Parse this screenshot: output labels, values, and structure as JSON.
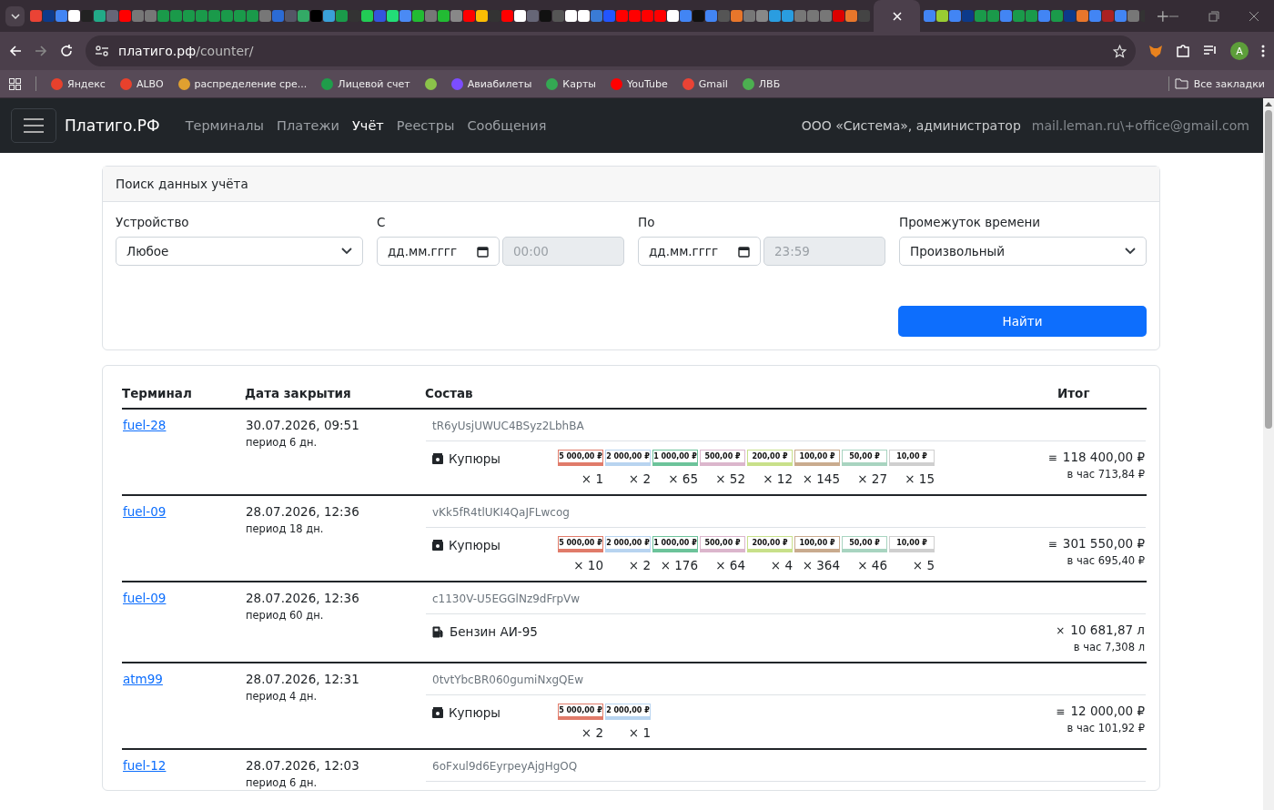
{
  "browser": {
    "url_host": "платиго.рф",
    "url_path": "/counter/",
    "bookmarks": [
      {
        "label": "Яндекс",
        "color": "#e8412c"
      },
      {
        "label": "ALBO",
        "color": "#e8412c"
      },
      {
        "label": "распределение сре...",
        "color": "#e0a030"
      },
      {
        "label": "Лицевой счет",
        "color": "#1f9d4a"
      },
      {
        "color": "#8bc34a"
      },
      {
        "label": "Авиабилеты",
        "color": "#7c4dff"
      },
      {
        "label": "Карты",
        "color": "#34a853"
      },
      {
        "label": "YouTube",
        "color": "#ff0000"
      },
      {
        "label": "Gmail",
        "color": "#ea4335"
      },
      {
        "label": "ЛВБ",
        "color": "#4caf50"
      }
    ],
    "all_bookmarks": "Все закладки",
    "profile": "A"
  },
  "navbar": {
    "brand": "Платиго.РФ",
    "links": [
      {
        "label": "Терминалы",
        "selected": false
      },
      {
        "label": "Платежи",
        "selected": false
      },
      {
        "label": "Учёт",
        "selected": true
      },
      {
        "label": "Реестры",
        "selected": false
      },
      {
        "label": "Сообщения",
        "selected": false
      }
    ],
    "user": "ООО «Система», администратор",
    "email": "mail.leman.ru\\+office@gmail.com"
  },
  "search": {
    "title": "Поиск данных учёта",
    "device_label": "Устройство",
    "device_value": "Любое",
    "from_label": "С",
    "from_date": "дд.мм.гггг",
    "from_time": "00:00",
    "to_label": "По",
    "to_date": "дд.мм.гггг",
    "to_time": "23:59",
    "range_label": "Промежуток времени",
    "range_value": "Произвольный",
    "button": "Найти"
  },
  "table": {
    "columns": [
      "Терминал",
      "Дата закрытия",
      "Состав",
      "Итог"
    ],
    "rows": [
      {
        "terminal": "fuel-28",
        "date": "30.07.2026, 09:51",
        "period": "период 6 дн.",
        "id": "tR6yUsjUWUC4BSyz2LbhBA",
        "item": {
          "kind": "bills",
          "label": "Купюры",
          "notes": [
            {
              "label": "5 000,00 ₽",
              "color": "#e07b6a",
              "count": "× 1"
            },
            {
              "label": "2 000,00 ₽",
              "color": "#b8d4f0",
              "count": "× 2"
            },
            {
              "label": "1 000,00 ₽",
              "color": "#6cc39a",
              "count": "× 65"
            },
            {
              "label": "500,00 ₽",
              "color": "#dbb6cc",
              "count": "× 52"
            },
            {
              "label": "200,00 ₽",
              "color": "#c8e08a",
              "count": "× 12"
            },
            {
              "label": "100,00 ₽",
              "color": "#c9ab8e",
              "count": "× 145"
            },
            {
              "label": "50,00 ₽",
              "color": "#a8d4c0",
              "count": "× 27"
            },
            {
              "label": "10,00 ₽",
              "color": "#cfcfcf",
              "count": "× 15"
            }
          ],
          "symbol": "≡",
          "total": "118 400,00 ₽",
          "per_hour": "в час 713,84 ₽"
        }
      },
      {
        "terminal": "fuel-09",
        "date": "28.07.2026, 12:36",
        "period": "период 18 дн.",
        "id": "vKk5fR4tlUKI4QaJFLwcog",
        "item": {
          "kind": "bills",
          "label": "Купюры",
          "notes": [
            {
              "label": "5 000,00 ₽",
              "color": "#e07b6a",
              "count": "× 10"
            },
            {
              "label": "2 000,00 ₽",
              "color": "#b8d4f0",
              "count": "× 2"
            },
            {
              "label": "1 000,00 ₽",
              "color": "#6cc39a",
              "count": "× 176"
            },
            {
              "label": "500,00 ₽",
              "color": "#dbb6cc",
              "count": "× 64"
            },
            {
              "label": "200,00 ₽",
              "color": "#c8e08a",
              "count": "× 4"
            },
            {
              "label": "100,00 ₽",
              "color": "#c9ab8e",
              "count": "× 364"
            },
            {
              "label": "50,00 ₽",
              "color": "#a8d4c0",
              "count": "× 46"
            },
            {
              "label": "10,00 ₽",
              "color": "#cfcfcf",
              "count": "× 5"
            }
          ],
          "symbol": "≡",
          "total": "301 550,00 ₽",
          "per_hour": "в час 695,40 ₽"
        }
      },
      {
        "terminal": "fuel-09",
        "date": "28.07.2026, 12:36",
        "period": "период 60 дн.",
        "id": "c1130V-U5EGGlNz9dFrpVw",
        "item": {
          "kind": "fuel",
          "label": "Бензин АИ-95",
          "symbol": "×",
          "total": "10 681,87 л",
          "per_hour": "в час 7,308 л"
        }
      },
      {
        "terminal": "atm99",
        "date": "28.07.2026, 12:31",
        "period": "период 4 дн.",
        "id": "0tvtYbcBR060gumiNxgQEw",
        "item": {
          "kind": "bills",
          "label": "Купюры",
          "notes": [
            {
              "label": "5 000,00 ₽",
              "color": "#e07b6a",
              "count": "× 2"
            },
            {
              "label": "2 000,00 ₽",
              "color": "#b8d4f0",
              "count": "× 1"
            }
          ],
          "symbol": "≡",
          "total": "12 000,00 ₽",
          "per_hour": "в час 101,92 ₽"
        }
      },
      {
        "terminal": "fuel-12",
        "date": "28.07.2026, 12:03",
        "period": "период 6 дн.",
        "id": "6oFxul9d6EyrpeyAjgHgOQ"
      }
    ]
  }
}
